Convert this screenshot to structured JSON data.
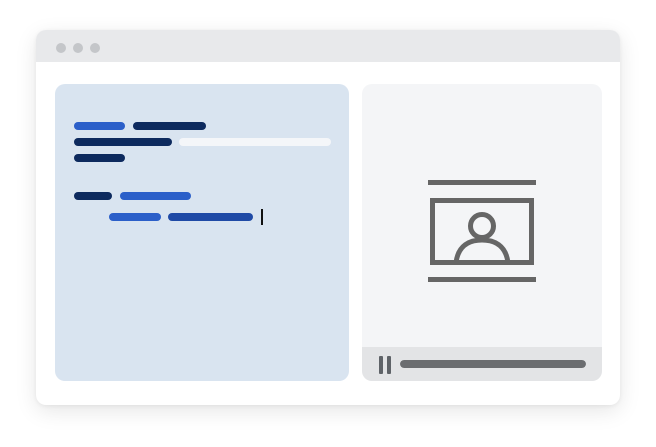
{
  "icons": {
    "window_controls": [
      "window-dot-icon",
      "window-dot-icon",
      "window-dot-icon"
    ],
    "media": "presenter-screen-icon",
    "playback": "pause-icon"
  },
  "colors": {
    "code_background": "#d9e4f0",
    "code_accent": "#2b5fc9",
    "code_dark": "#0d2a5e",
    "code_mid": "#1f4aa6",
    "code_highlight": "#f4f6f9",
    "video_background": "#f4f5f7",
    "icon_gray": "#666666"
  },
  "video_player": {
    "progress": 1.0
  }
}
